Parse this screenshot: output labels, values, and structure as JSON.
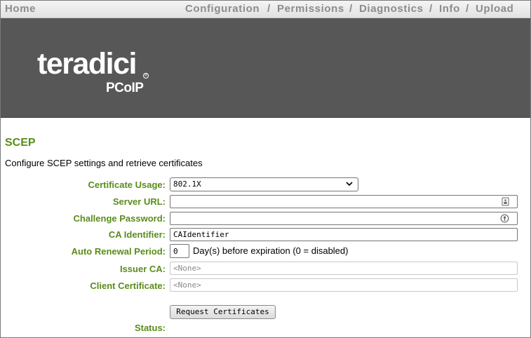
{
  "nav": {
    "home": "Home",
    "items": [
      "Configuration",
      "Permissions",
      "Diagnostics",
      "Info",
      "Upload"
    ],
    "separator": "/"
  },
  "banner": {
    "logo_main": "teradici",
    "logo_sub": "PCoIP",
    "logo_reg": "®"
  },
  "page": {
    "title": "SCEP",
    "description": "Configure SCEP settings and retrieve certificates"
  },
  "form": {
    "certificate_usage": {
      "label": "Certificate Usage:",
      "value": "802.1X"
    },
    "server_url": {
      "label": "Server URL:",
      "value": ""
    },
    "challenge_password": {
      "label": "Challenge Password:",
      "value": ""
    },
    "ca_identifier": {
      "label": "CA Identifier:",
      "value": "CAIdentifier"
    },
    "auto_renewal": {
      "label": "Auto Renewal Period:",
      "value": "0",
      "suffix": "Day(s) before expiration (0 = disabled)"
    },
    "issuer_ca": {
      "label": "Issuer CA:",
      "value": "<None>"
    },
    "client_certificate": {
      "label": "Client Certificate:",
      "value": "<None>"
    },
    "request_button": "Request Certificates",
    "status": {
      "label": "Status:",
      "value": ""
    }
  },
  "colors": {
    "accent_green": "#5a8c1a",
    "banner_gray": "#575757",
    "nav_text": "#8c8c8c"
  }
}
